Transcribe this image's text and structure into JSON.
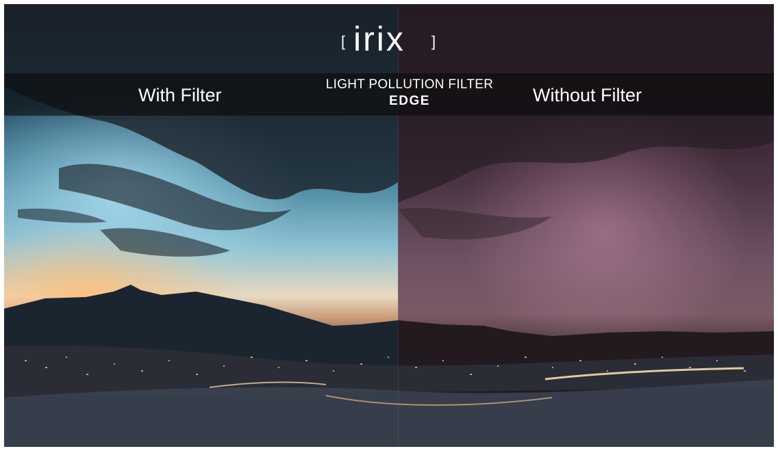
{
  "brand": {
    "logo_text": "irix",
    "logo_bracket_left": "[",
    "logo_bracket_right": "]"
  },
  "labels": {
    "left": "With Filter",
    "right": "Without Filter",
    "center_title": "LIGHT POLLUTION FILTER",
    "center_subtitle": "EDGE"
  },
  "colors": {
    "with_filter_sky": "#3f7d96",
    "without_filter_sky": "#6e5263",
    "band": "#0a0a0c",
    "text": "#ffffff"
  }
}
